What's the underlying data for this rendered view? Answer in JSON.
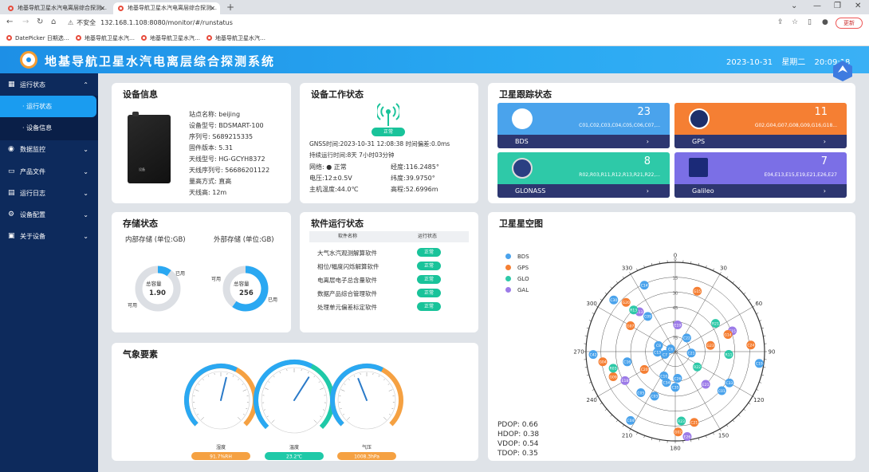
{
  "browser": {
    "tabs": [
      {
        "label": "地基导航卫星水汽电离层综合探测…"
      },
      {
        "label": "地基导航卫星水汽电离层综合探测…"
      }
    ],
    "url": "132.168.1.108:8080/monitor/#/runstatus",
    "security_label": "不安全",
    "update_label": "更新",
    "bookmarks": [
      "DatePicker 日期选…",
      "地基导航卫星水汽…",
      "地基导航卫星水汽…",
      "地基导航卫星水汽…"
    ]
  },
  "app": {
    "title": "地基导航卫星水汽电离层综合探测系统",
    "date": "2023-10-31",
    "weekday": "星期二",
    "time": "20:09:18"
  },
  "sidebar": {
    "items": [
      {
        "label": "运行状态",
        "icon": "grid-icon",
        "expanded": true
      },
      {
        "label": "数据监控",
        "icon": "eye-icon"
      },
      {
        "label": "产品文件",
        "icon": "folder-icon"
      },
      {
        "label": "运行日志",
        "icon": "log-icon"
      },
      {
        "label": "设备配置",
        "icon": "gear-icon"
      },
      {
        "label": "关于设备",
        "icon": "info-icon"
      }
    ],
    "subitems": [
      {
        "label": "· 运行状态",
        "active": true
      },
      {
        "label": "· 设备信息"
      }
    ]
  },
  "device_info": {
    "title": "设备信息",
    "image_label": "设备",
    "fields": [
      "站点名称:  beijing",
      "设备型号:  BDSMART-100",
      "序列号:  S689215335",
      "固件版本:  5.31",
      "天线型号:  HG-GCYH8372",
      "天线序列号:  56686201122",
      "量高方式:  直高",
      "天线高:  12m"
    ]
  },
  "work_status": {
    "title": "设备工作状态",
    "badge": "正常",
    "gnss_time": "GNSS时间:2023-10-31 12:08:38 时间偏差:0.0ms",
    "uptime": "持续运行时间:8天 7小时03分钟",
    "left": [
      "网络: ● 正常",
      "电压:12±0.5V",
      "主机温度:44.0℃"
    ],
    "right": [
      "经度:116.2485°",
      "纬度:39.9750°",
      "高程:52.6996m"
    ]
  },
  "sat_tracking": {
    "title": "卫星跟踪状态",
    "systems": [
      {
        "name": "BDS",
        "count": "23",
        "ids": "C01,C02,C03,C04,C05,C06,C07,...",
        "color": "#4aa3ec"
      },
      {
        "name": "GPS",
        "count": "11",
        "ids": "G02,G04,G07,G08,G09,G16,G18...",
        "color": "#f57f33"
      },
      {
        "name": "GLONASS",
        "count": "8",
        "ids": "R02,R03,R11,R12,R13,R21,R22,...",
        "color": "#2ec9a8"
      },
      {
        "name": "Galileo",
        "count": "7",
        "ids": "E04,E13,E15,E19,E21,E26,E27",
        "color": "#7b6fe6"
      }
    ]
  },
  "storage": {
    "title": "存储状态",
    "internal": {
      "label": "内部存储 (单位:GB)",
      "center_label": "总容量",
      "total": "1.90",
      "used_label": "已用",
      "free_label": "可用",
      "used_fraction": 0.1
    },
    "external": {
      "label": "外部存储 (单位:GB)",
      "center_label": "总容量",
      "total": "256",
      "used_label": "已用",
      "free_label": "可用",
      "used_fraction": 0.6
    }
  },
  "software": {
    "title": "软件运行状态",
    "col_name": "软件名称",
    "col_status": "运行状态",
    "rows": [
      {
        "name": "大气水汽观测解算软件",
        "status": "正常"
      },
      {
        "name": "相位/幅度闪烁解算软件",
        "status": "正常"
      },
      {
        "name": "电离层电子总含量软件",
        "status": "正常"
      },
      {
        "name": "数据产品综合管理软件",
        "status": "正常"
      },
      {
        "name": "处理单元偏差标定软件",
        "status": "正常"
      }
    ]
  },
  "weather": {
    "title": "气象要素",
    "gauges": [
      {
        "label": "湿度",
        "value_text": "91.7%RH",
        "pointer_fraction": 0.55,
        "color": "#f5a142"
      },
      {
        "label": "温度",
        "value_text": "23.2℃",
        "pointer_fraction": 0.62,
        "color": "#1fc9a8"
      },
      {
        "label": "气压",
        "value_text": "1008.3hPa",
        "pointer_fraction": 0.42,
        "color": "#f5a142"
      }
    ]
  },
  "skyplot": {
    "title": "卫星星空图",
    "legend": [
      {
        "name": "BDS",
        "color": "#4aa3ec"
      },
      {
        "name": "GPS",
        "color": "#f57f33"
      },
      {
        "name": "GLO",
        "color": "#2ec9a8"
      },
      {
        "name": "GAL",
        "color": "#9c7be8"
      }
    ],
    "angle_labels": [
      "0",
      "30",
      "60",
      "90",
      "120",
      "150",
      "180",
      "210",
      "240",
      "270",
      "300",
      "330"
    ],
    "ring_labels": [
      "0",
      "15",
      "30",
      "45",
      "60",
      "75",
      "90"
    ],
    "dop": [
      "PDOP: 0.66",
      "HDOP: 0.38",
      "VDOP: 0.54",
      "TDOP: 0.35"
    ],
    "sats": [
      {
        "id": "C14",
        "sys": "BDS",
        "az": 335,
        "r": 0.82
      },
      {
        "id": "G15",
        "sys": "GPS",
        "az": 20,
        "r": 0.72
      },
      {
        "id": "C30",
        "sys": "BDS",
        "az": 310,
        "r": 0.9
      },
      {
        "id": "G20",
        "sys": "GPS",
        "az": 315,
        "r": 0.78
      },
      {
        "id": "E13",
        "sys": "GAL",
        "az": 318,
        "r": 0.6
      },
      {
        "id": "R13",
        "sys": "GLO",
        "az": 315,
        "r": 0.66
      },
      {
        "id": "G07",
        "sys": "GPS",
        "az": 300,
        "r": 0.58
      },
      {
        "id": "C09",
        "sys": "BDS",
        "az": 322,
        "r": 0.5
      },
      {
        "id": "E19",
        "sys": "GAL",
        "az": 5,
        "r": 0.3
      },
      {
        "id": "R21",
        "sys": "GLO",
        "az": 55,
        "r": 0.55
      },
      {
        "id": "E15",
        "sys": "GAL",
        "az": 70,
        "r": 0.68
      },
      {
        "id": "C21",
        "sys": "BDS",
        "az": 95,
        "r": 0.18
      },
      {
        "id": "G14",
        "sys": "GPS",
        "az": 72,
        "r": 0.62
      },
      {
        "id": "C24",
        "sys": "GPS",
        "az": 85,
        "r": 0.85
      },
      {
        "id": "R11",
        "sys": "GLO",
        "az": 93,
        "r": 0.6
      },
      {
        "id": "G23",
        "sys": "GPS",
        "az": 80,
        "r": 0.4
      },
      {
        "id": "C8",
        "sys": "BDS",
        "az": 290,
        "r": 0.2
      },
      {
        "id": "C42",
        "sys": "BDS",
        "az": 268,
        "r": 0.92
      },
      {
        "id": "C6",
        "sys": "BDS",
        "az": 300,
        "r": 0.06
      },
      {
        "id": "C7",
        "sys": "BDS",
        "az": 255,
        "r": 0.12
      },
      {
        "id": "C13",
        "sys": "BDS",
        "az": 268,
        "r": 0.2
      },
      {
        "id": "E18",
        "sys": "GAL",
        "az": 240,
        "r": 0.65
      },
      {
        "id": "R22",
        "sys": "GLO",
        "az": 125,
        "r": 0.3
      },
      {
        "id": "C20",
        "sys": "GPS",
        "az": 240,
        "r": 0.4
      },
      {
        "id": "G09",
        "sys": "GPS",
        "az": 248,
        "r": 0.75
      },
      {
        "id": "G04",
        "sys": "GPS",
        "az": 262,
        "r": 0.82
      },
      {
        "id": "R03",
        "sys": "GLO",
        "az": 255,
        "r": 0.72
      },
      {
        "id": "C16",
        "sys": "BDS",
        "az": 258,
        "r": 0.55
      },
      {
        "id": "C33",
        "sys": "BDS",
        "az": 120,
        "r": 0.7
      },
      {
        "id": "C19",
        "sys": "BDS",
        "az": 98,
        "r": 0.95
      },
      {
        "id": "C26",
        "sys": "BDS",
        "az": 175,
        "r": 0.3
      },
      {
        "id": "C35",
        "sys": "BDS",
        "az": 180,
        "r": 0.4
      },
      {
        "id": "C34",
        "sys": "BDS",
        "az": 196,
        "r": 0.36
      },
      {
        "id": "C10",
        "sys": "BDS",
        "az": 205,
        "r": 0.3
      },
      {
        "id": "C05",
        "sys": "BDS",
        "az": 220,
        "r": 0.6
      },
      {
        "id": "C03",
        "sys": "BDS",
        "az": 205,
        "r": 0.55
      },
      {
        "id": "C04",
        "sys": "BDS",
        "az": 213,
        "r": 0.92
      },
      {
        "id": "R23",
        "sys": "GLO",
        "az": 175,
        "r": 0.78
      },
      {
        "id": "C21b",
        "label": "C21",
        "sys": "GPS",
        "az": 165,
        "r": 0.82
      },
      {
        "id": "G02",
        "sys": "GPS",
        "az": 178,
        "r": 0.9
      },
      {
        "id": "E26",
        "sys": "GAL",
        "az": 172,
        "r": 0.96
      },
      {
        "id": "C01",
        "sys": "BDS",
        "az": 130,
        "r": 0.68
      },
      {
        "id": "E21",
        "sys": "GAL",
        "az": 137,
        "r": 0.5
      },
      {
        "id": "C22",
        "sys": "BDS",
        "az": 40,
        "r": 0.2
      }
    ]
  }
}
